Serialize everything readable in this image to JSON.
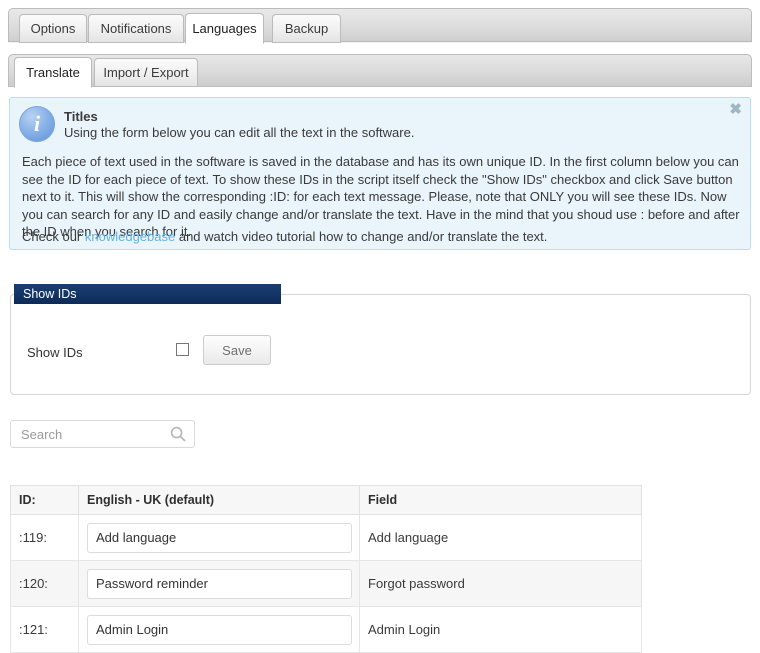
{
  "tabs_outer": [
    {
      "label": "Options",
      "active": false
    },
    {
      "label": "Notifications",
      "active": false
    },
    {
      "label": "Languages",
      "active": true
    },
    {
      "label": "Backup",
      "active": false
    }
  ],
  "tabs_inner": [
    {
      "label": "Translate",
      "active": true
    },
    {
      "label": "Import / Export",
      "active": false
    }
  ],
  "notice": {
    "close_label": "✖",
    "icon": "info-icon",
    "icon_glyph": "i",
    "title": "Titles",
    "subtitle": "Using the form below you can edit all the text in the software.",
    "body": "Each piece of text used in the software is saved in the database and has its own unique ID. In the first column below you can see the ID for each piece of text. To show these IDs in the script itself check the \"Show IDs\" checkbox and click Save button next to it. This will show the corresponding :ID: for each text message. Please, note that ONLY you will see these IDs. Now you can search for any ID and easily change and/or translate the text. Have in the mind that you shoud use : before and after the ID when you search for it.",
    "footer_pre": "Check our ",
    "footer_link": "knowledgebase",
    "footer_post": " and watch video tutorial how to change and/or translate the text.",
    "link_color": "#63b2e6",
    "background_color": "#e9f4fb",
    "border_color": "#b9dcef"
  },
  "panel": {
    "legend": "Show IDs",
    "legend_color": "#123466",
    "row_label": "Show IDs",
    "checkbox_checked": false,
    "save_label": "Save"
  },
  "search": {
    "placeholder": "Search",
    "value": "",
    "icon": "search-icon"
  },
  "table": {
    "columns": [
      "ID:",
      "English - UK (default)",
      "Field"
    ],
    "rows": [
      {
        "id": ":119:",
        "english": "Add language",
        "field": "Add language"
      },
      {
        "id": ":120:",
        "english": "Password reminder",
        "field": "Forgot password"
      },
      {
        "id": ":121:",
        "english": "Admin Login",
        "field": "Admin Login"
      }
    ]
  }
}
